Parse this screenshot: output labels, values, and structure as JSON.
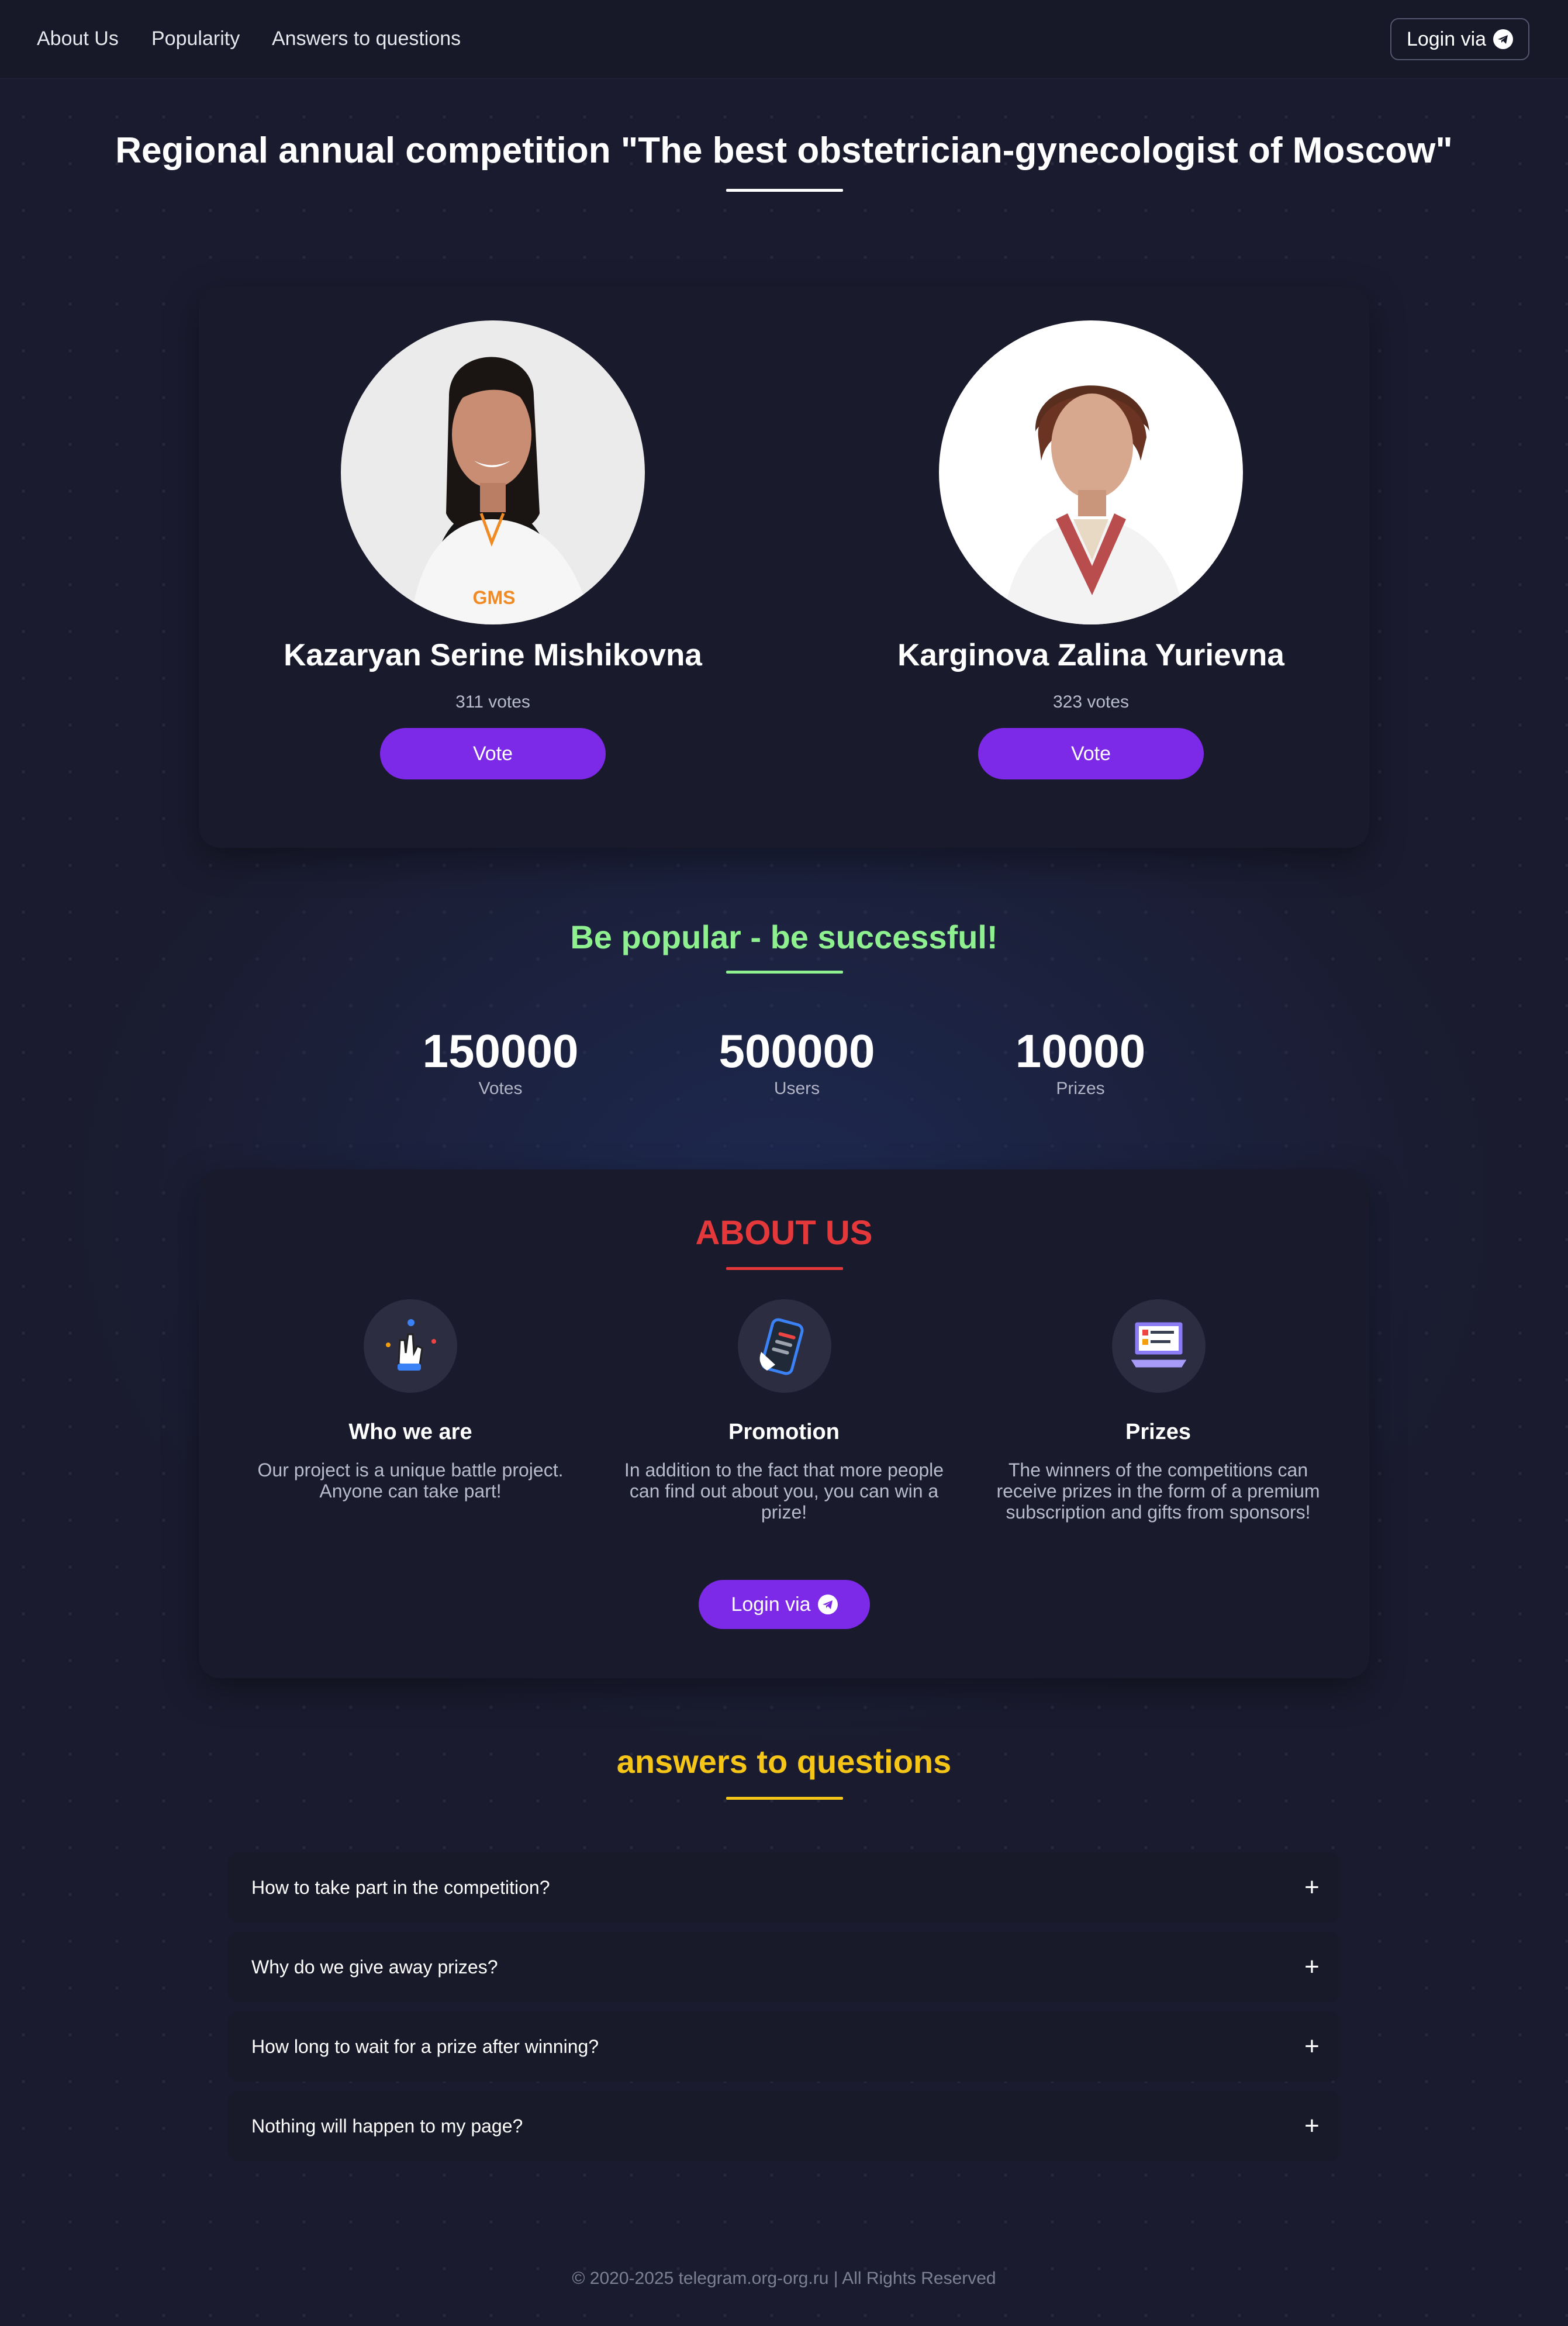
{
  "nav": {
    "links": [
      "About Us",
      "Popularity",
      "Answers to questions"
    ],
    "login_label": "Login via"
  },
  "page_title": "Regional annual competition \"The best obstetrician-gynecologist of Moscow\"",
  "candidates": [
    {
      "name": "Kazaryan Serine Mishikovna",
      "votes": "311 votes",
      "vote_label": "Vote",
      "logo": "GMS"
    },
    {
      "name": "Karginova Zalina Yurievna",
      "votes": "323 votes",
      "vote_label": "Vote"
    }
  ],
  "popularity": {
    "title": "Be popular - be successful!",
    "stats": [
      {
        "value": "150000",
        "label": "Votes"
      },
      {
        "value": "500000",
        "label": "Users"
      },
      {
        "value": "10000",
        "label": "Prizes"
      }
    ]
  },
  "about": {
    "title": "ABOUT US",
    "features": [
      {
        "icon": "rock-hand-icon",
        "title": "Who we are",
        "text": "Our project is a unique battle project. Anyone can take part!"
      },
      {
        "icon": "phone-hand-icon",
        "title": "Promotion",
        "text": "In addition to the fact that more people can find out about you, you can win a prize!"
      },
      {
        "icon": "laptop-icon",
        "title": "Prizes",
        "text": "The winners of the competitions can receive prizes in the form of a premium subscription and gifts from sponsors!"
      }
    ],
    "login_label": "Login via"
  },
  "faq": {
    "title": "answers to questions",
    "items": [
      "How to take part in the competition?",
      "Why do we give away prizes?",
      "How long to wait for a prize after winning?",
      "Nothing will happen to my page?"
    ]
  },
  "footer": "© 2020-2025 telegram.org-org.ru | All Rights Reserved",
  "colors": {
    "accent": "#7d2ae8",
    "green_title": "#8ff08f",
    "red_title": "#e5383b",
    "yellow_title": "#f5c518",
    "background": "#1a1b2e"
  }
}
